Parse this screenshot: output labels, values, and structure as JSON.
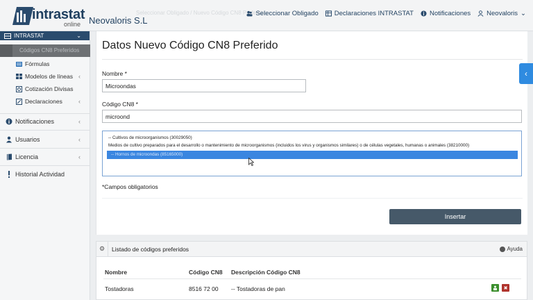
{
  "header": {
    "logo_text": "intrastat",
    "logo_sub": "online",
    "company": "Neovaloris S.L",
    "ghost_breadcrumb": "Seleccionar Obligado  /  Nuevo Código CN8 Preferido",
    "nav": [
      {
        "label": "Seleccionar Obligado",
        "icon": "users-icon"
      },
      {
        "label": "Declaraciones INTRASTAT",
        "icon": "table-icon"
      },
      {
        "label": "Notificaciones",
        "icon": "info-icon"
      },
      {
        "label": "Neovaloris",
        "icon": "user-icon",
        "caret": "⌄"
      }
    ]
  },
  "sidebar": {
    "section": "INTRASTAT",
    "active_item": "Códigos CN8 Preferidos",
    "items": [
      {
        "label": "Fórmulas",
        "icon": "list-icon"
      },
      {
        "label": "Modelos de líneas",
        "icon": "grid-icon",
        "arrow": "‹"
      },
      {
        "label": "Cotización Divisas",
        "icon": "currency-icon"
      },
      {
        "label": "Declaraciones",
        "icon": "edit-icon",
        "arrow": "‹"
      }
    ],
    "top_items": [
      {
        "label": "Notificaciones",
        "icon": "info-icon",
        "arrow": "‹"
      },
      {
        "label": "Usuarios",
        "icon": "user-icon",
        "arrow": "‹"
      },
      {
        "label": "Licencia",
        "icon": "book-icon",
        "arrow": "‹"
      },
      {
        "label": "Historial Actividad",
        "icon": "exclamation-icon",
        "arrow": "‹"
      }
    ]
  },
  "form": {
    "title": "Datos Nuevo Código CN8 Preferido",
    "nombre_label": "Nombre *",
    "nombre_value": "Microondas",
    "cn8_label": "Código CN8 *",
    "cn8_value": "microond",
    "options": [
      "-- Cultivos de microorganismos (30029050)",
      "Medios de cultivo preparados para el desarrollo o mantenimiento de microorganismos (incluidos los virus y organismos similares) o de células vegetales, humanas o animales (38210000)",
      "-- Hornos de microondas (85165000)"
    ],
    "required_note": "*Campos obligatorios",
    "insert_label": "Insertar"
  },
  "toggle": {
    "label": "‹"
  },
  "list": {
    "title": "Listado de códigos preferidos",
    "help_label": "Ayuda",
    "columns": [
      "Nombre",
      "Código CN8",
      "Descripción Código CN8"
    ],
    "rows": [
      {
        "nombre": "Tostadoras",
        "codigo": "8516 72 00",
        "descripcion": "-- Tostadoras de pan"
      }
    ],
    "colors": {
      "edit": "#3c8f2e",
      "delete": "#b0342d"
    }
  }
}
